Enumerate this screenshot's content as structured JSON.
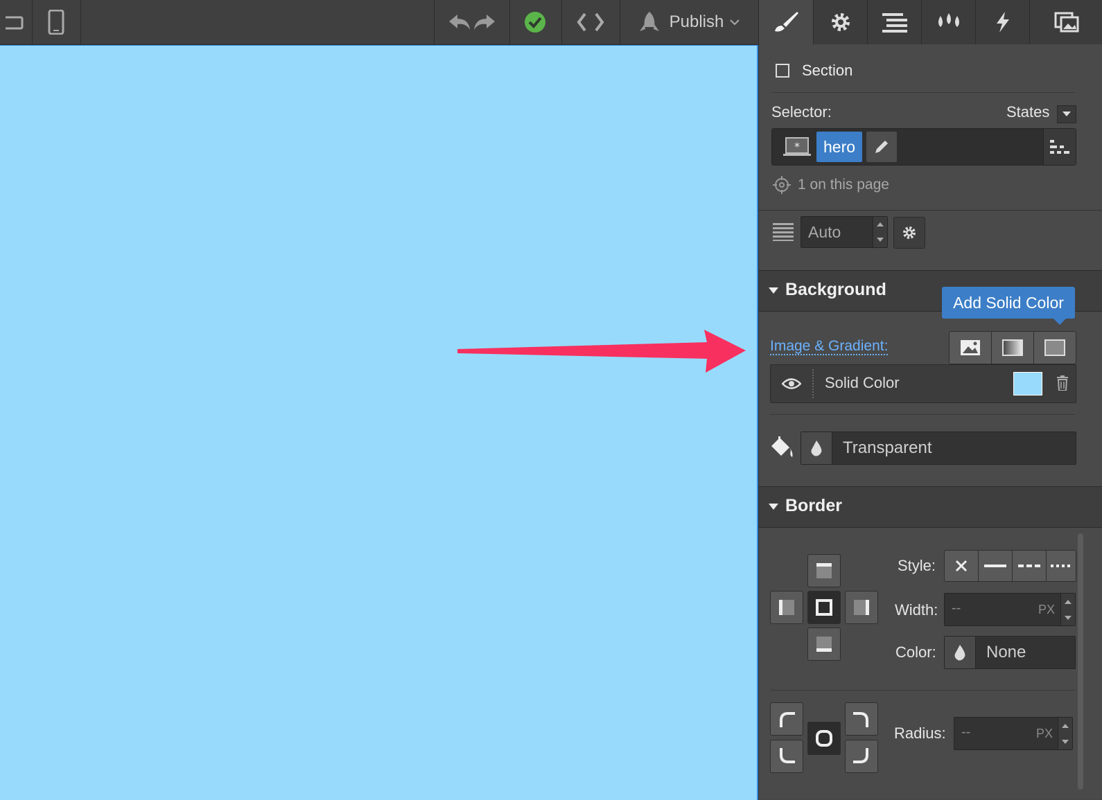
{
  "toolbar": {
    "publish_label": "Publish"
  },
  "panel": {
    "element_type": "Section",
    "selector_label": "Selector:",
    "states_label": "States",
    "selector_class": "hero",
    "usage_text": "1 on this page",
    "display_value": "Auto",
    "background": {
      "title": "Background",
      "tooltip": "Add Solid Color",
      "image_gradient_label": "Image & Gradient:",
      "layer_name": "Solid Color",
      "layer_color": "#98dafc",
      "fill_color": "Transparent"
    },
    "border": {
      "title": "Border",
      "style_label": "Style:",
      "width_label": "Width:",
      "width_value": "--",
      "width_unit": "PX",
      "color_label": "Color:",
      "color_value": "None",
      "radius_label": "Radius:",
      "radius_value": "--",
      "radius_unit": "PX"
    }
  },
  "colors": {
    "canvas_bg": "#98dafc",
    "accent_blue": "#3c7ec7",
    "annotation_arrow": "#f7305f",
    "published_check": "#5bb54a"
  }
}
